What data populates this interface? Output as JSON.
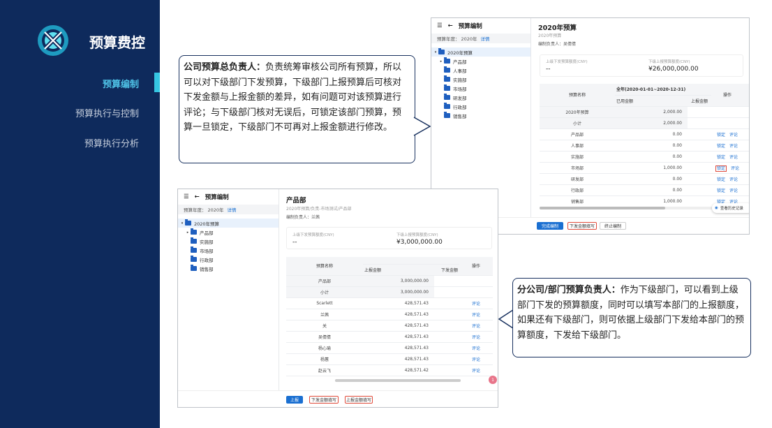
{
  "app": {
    "title": "预算费控"
  },
  "nav": {
    "items": [
      "预算编制",
      "预算执行与控制",
      "预算执行分析"
    ]
  },
  "callout_top": {
    "title": "公司预算总负责人：",
    "body": "负责统筹审核公司所有预算，所以可以对下级部门下发预算，下级部门上报预算后可核对下发金额与上报金额的差异，如有问题可对该预算进行评论；与下级部门核对无误后，可锁定该部门预算，预算一旦锁定，下级部门不可再对上报金额进行修改。"
  },
  "callout_bottom": {
    "title": "分公司/部门预算负责人：",
    "body": "作为下级部门，可以看到上级部门下发的预算额度，同时可以填写本部门的上报额度，如果还有下级部门，则可依据上级部门下发给本部门的预算额度，下发给下级部门。"
  },
  "shot_top": {
    "sidebar": {
      "title": "预算编制",
      "year_label": "预算年度：",
      "year": "2020年",
      "detail": "详情",
      "tree": [
        "2020年预算",
        "产品部",
        "人事部",
        "实施部",
        "市场部",
        "研发部",
        "行政部",
        "销售部"
      ]
    },
    "title": "2020年预算",
    "subtitle": "2020年预算",
    "owner_label": "编制负责人：",
    "owner": "吴倩倩",
    "card": {
      "l1": "上级下发预算额度(CNY)",
      "v1": "--",
      "l2": "下级上报预算额度(CNY)",
      "v2": "¥26,000,000.00"
    },
    "table": {
      "col_name": "预算名称",
      "col_period": "全年(2020-01-01~2020-12-31)",
      "col_used": "已用金额",
      "col_report": "上报金额",
      "col_op": "操作",
      "rows": [
        {
          "name": "2020年预算",
          "used": "2,000.00",
          "ops": []
        },
        {
          "name": "小计",
          "used": "2,000.00",
          "ops": []
        },
        {
          "name": "产品部",
          "used": "0.00",
          "ops": [
            "锁定",
            "评论"
          ]
        },
        {
          "name": "人事部",
          "used": "0.00",
          "ops": [
            "锁定",
            "评论"
          ]
        },
        {
          "name": "实施部",
          "used": "0.00",
          "ops": [
            "锁定",
            "评论"
          ]
        },
        {
          "name": "市场部",
          "used": "1,000.00",
          "ops": [
            "锁定",
            "评论"
          ]
        },
        {
          "name": "研发部",
          "used": "0.00",
          "ops": [
            "锁定",
            "评论"
          ]
        },
        {
          "name": "行政部",
          "used": "0.00",
          "ops": [
            "锁定",
            "评论"
          ]
        },
        {
          "name": "销售部",
          "used": "1,000.00",
          "ops": [
            "锁定",
            "评论"
          ]
        }
      ]
    },
    "history": "查看历史记录",
    "buttons": {
      "finish": "完成编制",
      "send": "下发金额填写",
      "stop": "终止编制"
    }
  },
  "shot_bottom": {
    "sidebar": {
      "title": "预算编制",
      "year_label": "预算年度：",
      "year": "2020年",
      "detail": "详情",
      "tree": [
        "2020年预算",
        "产品部",
        "实施部",
        "市场部",
        "行政部",
        "销售部"
      ]
    },
    "title": "产品部",
    "subtitle": "2020年预算/负责-市场测试/产品部",
    "owner_label": "编制负责人：",
    "owner": "兰茜",
    "card": {
      "l1": "上级下发预算额度(CNY)",
      "v1": "--",
      "l2": "下级上报预算额度(CNY)",
      "v2": "¥3,000,000.00"
    },
    "table": {
      "col_name": "预算名称",
      "col_report": "上报金额",
      "col_send": "下发金额",
      "col_op": "操作",
      "rows": [
        {
          "name": "产品部",
          "report": "3,000,000.00",
          "ops": []
        },
        {
          "name": "小计",
          "report": "3,000,000.00",
          "ops": []
        },
        {
          "name": "Scarlett",
          "report": "428,571.43",
          "ops": [
            "评论"
          ]
        },
        {
          "name": "兰茜",
          "report": "428,571.43",
          "ops": [
            "评论"
          ]
        },
        {
          "name": "关",
          "report": "428,571.43",
          "ops": [
            "评论"
          ]
        },
        {
          "name": "吴倩倩",
          "report": "428,571.43",
          "ops": [
            "评论"
          ]
        },
        {
          "name": "杨心瑜",
          "report": "428,571.43",
          "ops": [
            "评论"
          ]
        },
        {
          "name": "杨蕙",
          "report": "428,571.43",
          "ops": [
            "评论"
          ]
        },
        {
          "name": "赵云飞",
          "report": "428,571.42",
          "ops": [
            "评论"
          ]
        }
      ]
    },
    "badge": "1",
    "buttons": {
      "report": "上报",
      "send": "下发金额填写",
      "fill": "上报金额填写"
    }
  },
  "colors": {
    "sidebar_bg": "#0e2a5c",
    "accent": "#35c6e2",
    "primary": "#1a6fd1",
    "highlight": "#e04a3a"
  }
}
